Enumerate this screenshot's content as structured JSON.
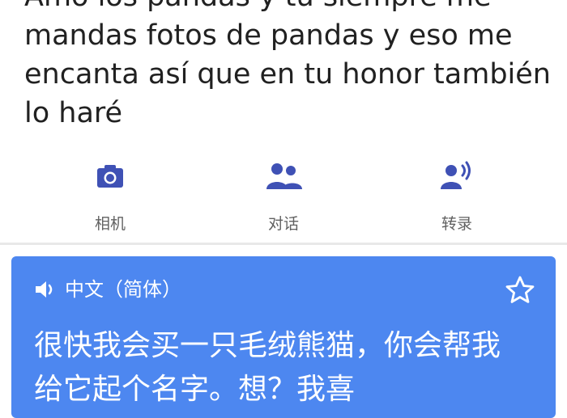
{
  "source": {
    "text": "Amo los pandas y tú siempre me mandas fotos de pandas y eso me encanta así que en tu honor también lo haré"
  },
  "actions": [
    {
      "label": "相机",
      "icon": "camera-icon"
    },
    {
      "label": "对话",
      "icon": "conversation-icon"
    },
    {
      "label": "转录",
      "icon": "transcribe-icon"
    }
  ],
  "translation": {
    "language": "中文（简体）",
    "text": "很快我会买一只毛绒熊猫，你会帮我给它起个名字。想？我喜"
  },
  "colors": {
    "accent": "#3f51b5",
    "card": "#4d87f0",
    "label": "#616161",
    "text": "#212121"
  }
}
